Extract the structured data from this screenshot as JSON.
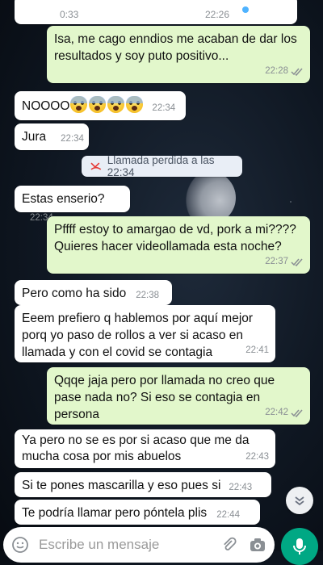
{
  "top_message": {
    "duration": "0:33",
    "time": "22:26"
  },
  "messages": [
    {
      "id": "m1",
      "dir": "out",
      "text": "Isa, me cago enndios me acaban de dar los resultados y soy puto positivo...",
      "time": "22:28"
    },
    {
      "id": "m2",
      "dir": "in",
      "text": "NOOOO",
      "emoji_count": 4,
      "time": "22:34"
    },
    {
      "id": "m3",
      "dir": "in",
      "text": "Jura",
      "time": "22:34"
    },
    {
      "id": "m4",
      "dir": "in",
      "text": "Estas enserio?",
      "time": "22:34"
    },
    {
      "id": "m5",
      "dir": "out",
      "text": "Pffff estoy to amargao de vd, pork a mi???? Quieres hacer videollamada esta noche?",
      "time": "22:37"
    },
    {
      "id": "m6",
      "dir": "in",
      "text": "Pero como ha sido",
      "time": "22:38"
    },
    {
      "id": "m7",
      "dir": "in",
      "text": "Eeem prefiero q hablemos por aquí mejor porq yo paso de rollos a ver si acaso en llamada y con el covid se contagia",
      "time": "22:41"
    },
    {
      "id": "m8",
      "dir": "out",
      "text": "Qqqe jaja pero por llamada no creo que pase nada no? Si eso se contagia en persona",
      "time": "22:42"
    },
    {
      "id": "m9",
      "dir": "in",
      "text": "Ya pero no se es por si acaso que me da mucha cosa por mis abuelos",
      "time": "22:43"
    },
    {
      "id": "m10",
      "dir": "in",
      "text": "Si te pones mascarilla y eso pues si",
      "time": "22:43"
    },
    {
      "id": "m11",
      "dir": "in",
      "text": "Te podría llamar pero póntela plis",
      "time": "22:44"
    }
  ],
  "missed_call": {
    "text": "Llamada perdida a las 22:34"
  },
  "input": {
    "placeholder": "Escribe un mensaje"
  },
  "colors": {
    "outgoing": "#e2f7cb",
    "incoming": "#ffffff",
    "accent": "#00a884",
    "tick_read": "#8a8f94"
  },
  "icons": [
    "emoji-icon",
    "attach-icon",
    "camera-icon",
    "mic-icon",
    "chevron-down-icon",
    "missed-call-icon",
    "double-tick-icon"
  ]
}
